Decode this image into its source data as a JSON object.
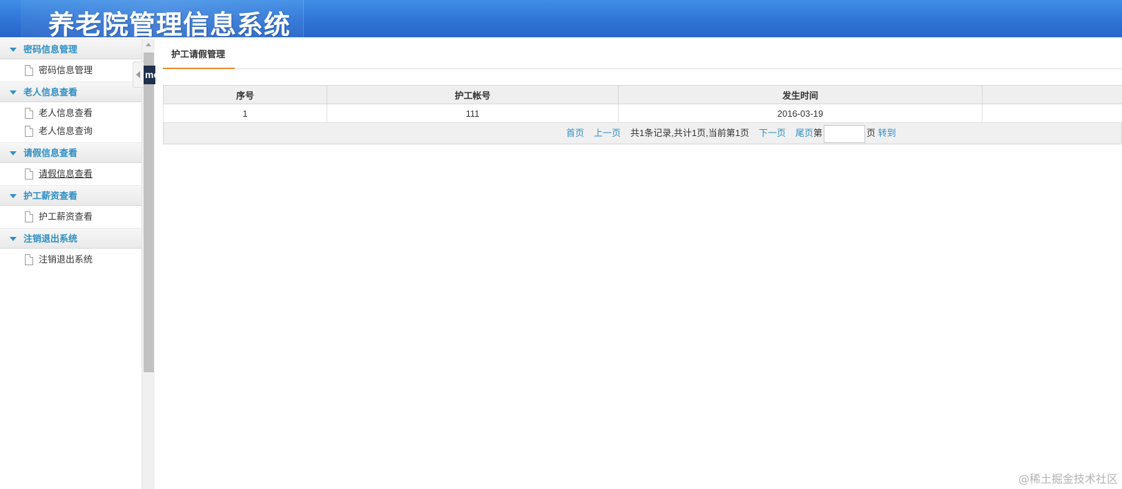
{
  "header": {
    "title": "养老院管理信息系统"
  },
  "sidebar": {
    "groups": [
      {
        "title": "密码信息管理",
        "items": [
          {
            "label": "密码信息管理"
          }
        ]
      },
      {
        "title": "老人信息查看",
        "items": [
          {
            "label": "老人信息查看"
          },
          {
            "label": "老人信息查询"
          }
        ]
      },
      {
        "title": "请假信息查看",
        "items": [
          {
            "label": "请假信息查看"
          }
        ]
      },
      {
        "title": "护工薪资查看",
        "items": [
          {
            "label": "护工薪资查看"
          }
        ]
      },
      {
        "title": "注销退出系统",
        "items": [
          {
            "label": "注销退出系统"
          }
        ]
      }
    ]
  },
  "badge": {
    "text": "mc"
  },
  "main": {
    "tab": {
      "label": "护工请假管理"
    },
    "table": {
      "columns": [
        "序号",
        "护工帐号",
        "发生时间",
        ""
      ],
      "rows": [
        [
          "1",
          "111",
          "2016-03-19",
          ""
        ]
      ]
    },
    "pager": {
      "first": "首页",
      "prev": "上一页",
      "info": "共1条记录,共计1页,当前第1页",
      "next": "下一页",
      "last": "尾页",
      "page_prefix": "第",
      "page_input_value": "",
      "page_suffix": "页",
      "goto": "转到"
    }
  },
  "watermark": "@稀土掘金技术社区",
  "colors": {
    "header": "#2f74d6",
    "accent": "#2f8fc4",
    "tab_underline": "#e48a2b"
  }
}
